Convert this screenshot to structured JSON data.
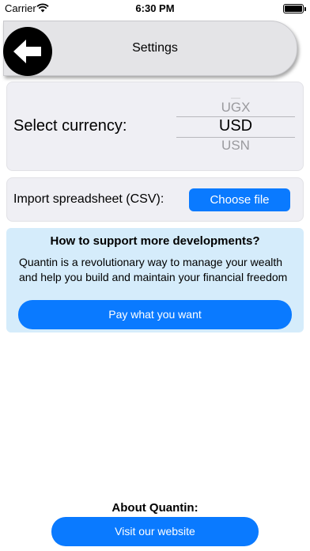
{
  "status_bar": {
    "carrier": "Carrier",
    "time": "6:30 PM",
    "wifi_icon": "wifi-icon",
    "battery_icon": "battery-icon"
  },
  "header": {
    "title": "Settings",
    "back_icon": "arrow-left-icon"
  },
  "currency": {
    "label": "Select currency:",
    "options_visible": [
      "UGX",
      "USD",
      "USN"
    ],
    "selected": "USD"
  },
  "import": {
    "label": "Import spreadsheet (CSV):",
    "button_label": "Choose file"
  },
  "support": {
    "title": "How to support more developments?",
    "body": "Quantin is a revolutionary way to manage your wealth and help you build and maintain your financial freedom",
    "button_label": "Pay what you want"
  },
  "about": {
    "title": "About Quantin:",
    "button_label": "Visit our website"
  },
  "colors": {
    "accent": "#0a7aff",
    "support_bg": "#d5ecfb",
    "card_bg": "#efeff4",
    "header_bg": "#e4e4e7"
  }
}
